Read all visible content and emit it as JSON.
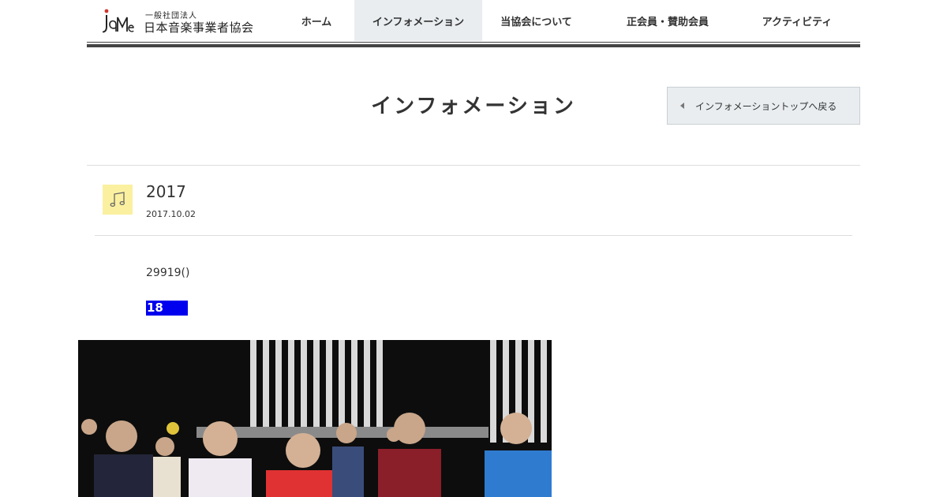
{
  "header": {
    "logo_small": "一般社団法人",
    "logo_big": "日本音楽事業者協会",
    "nav": [
      {
        "label": "ホーム",
        "active": false
      },
      {
        "label": "インフォメーション",
        "active": true
      },
      {
        "label": "当協会について",
        "active": false
      },
      {
        "label": "正会員・賛助会員",
        "active": false
      },
      {
        "label": "アクティビティ",
        "active": false
      }
    ]
  },
  "page": {
    "title": "インフォメーション",
    "back_button": "インフォメーショントップへ戻る"
  },
  "article": {
    "category_icon": "music-note-icon",
    "title": "2017",
    "date": "2017.10.02",
    "body_text": "29919()",
    "highlight_text": "18"
  },
  "colors": {
    "nav_active_bg": "#e9edf0",
    "category_icon_bg": "#faf0a0",
    "highlight_bg": "#0000ee",
    "logo_accent": "#d0342c"
  }
}
